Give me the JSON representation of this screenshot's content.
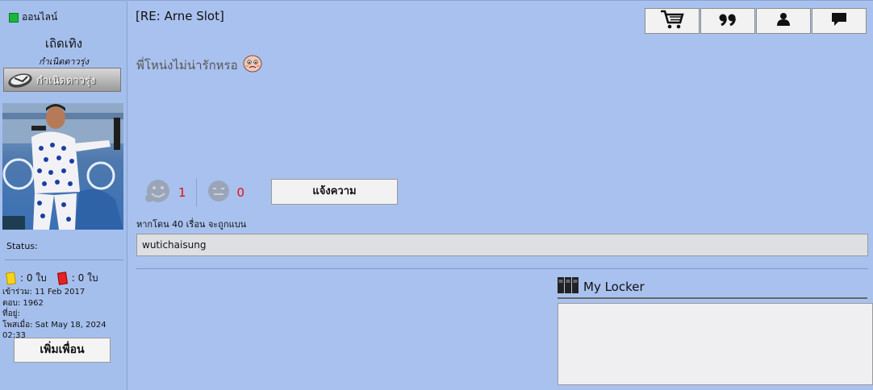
{
  "user": {
    "online_label": "ออนไลน์",
    "username": "เถิดเทิง",
    "rank_text": "กำเนิดดาวรุ่ง",
    "rank_badge_label": "กำเนิดดาวรุ่ง",
    "status_label": "Status:",
    "yellow_cards": ": 0 ใบ",
    "red_cards": ": 0 ใบ",
    "joined": "เข้าร่วม: 11 Feb 2017",
    "replies": "ตอบ: 1962",
    "address": "ที่อยู่:",
    "posted": "โพสเมื่อ: Sat May 18, 2024 02:33",
    "add_friend": "เพิ่มเพื่อน",
    "online_color": "#17b83a"
  },
  "post": {
    "title": "[RE: Arne Slot]",
    "message": "พี่โหน่งไม่น่ารักหรอ",
    "like_count": "1",
    "dislike_count": "0",
    "report_label": "แจ้งความ",
    "ban_note": "หากโดน 40 เรื่อน จะถูกแบน",
    "signature": "wutichaisung"
  },
  "toolbar": {
    "icons": [
      "cart-icon",
      "quote-icon",
      "user-icon",
      "chat-icon"
    ]
  },
  "locker": {
    "title": "My Locker"
  }
}
